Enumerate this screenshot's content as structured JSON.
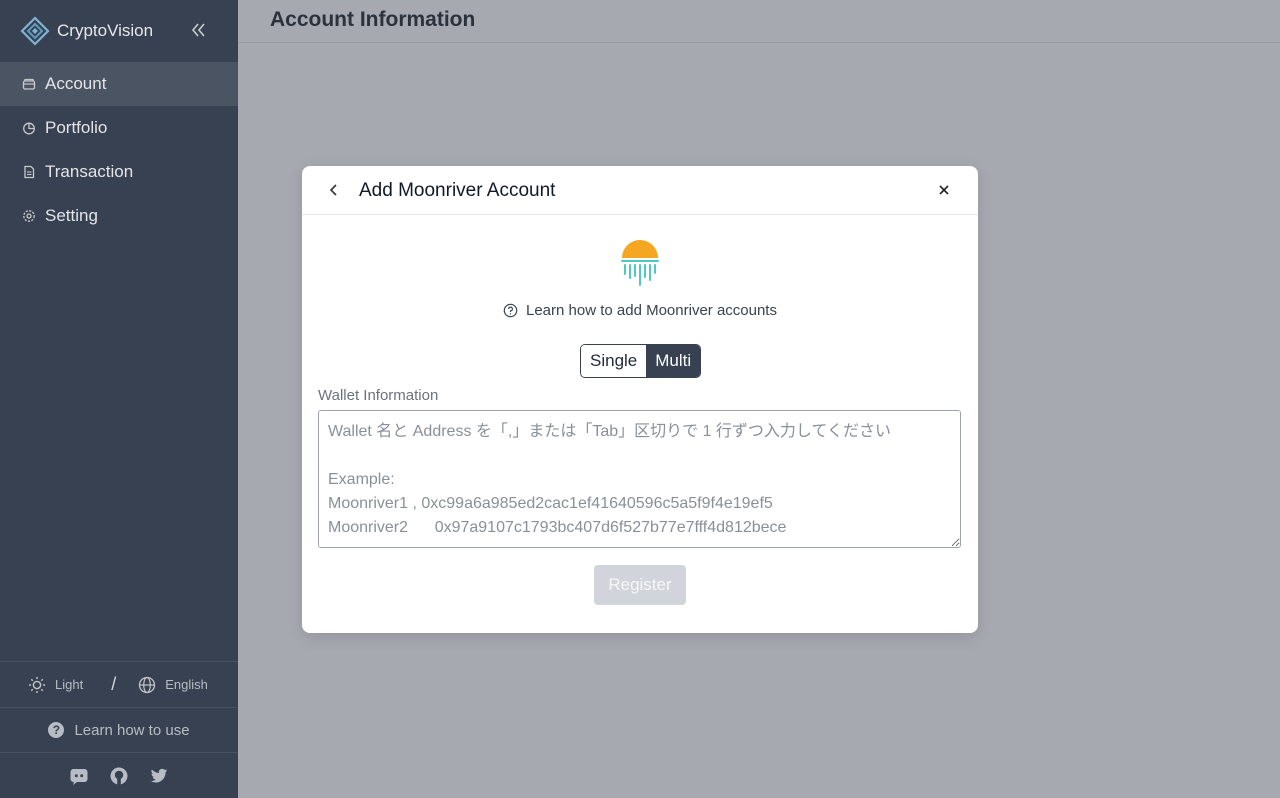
{
  "app": {
    "name": "CryptoVision"
  },
  "sidebar": {
    "items": [
      {
        "label": "Account",
        "icon": "account-icon",
        "active": true
      },
      {
        "label": "Portfolio",
        "icon": "pie-chart-icon",
        "active": false
      },
      {
        "label": "Transaction",
        "icon": "document-icon",
        "active": false
      },
      {
        "label": "Setting",
        "icon": "gear-icon",
        "active": false
      }
    ],
    "theme_label": "Light",
    "language_label": "English",
    "separator": "/",
    "help_label": "Learn how to use",
    "help_glyph": "?",
    "social": [
      "discord-icon",
      "github-icon",
      "twitter-icon"
    ]
  },
  "header": {
    "title": "Account Information"
  },
  "modal": {
    "title": "Add Moonriver Account",
    "learn_link": "Learn how to add Moonriver accounts",
    "modes": {
      "single": "Single",
      "multi": "Multi",
      "selected": "Multi"
    },
    "field_label": "Wallet Information",
    "placeholder": "Wallet 名と Address を「,」または「Tab」区切りで 1 行ずつ入力してください\n\nExample:\nMoonriver1 , 0xc99a6a985ed2cac1ef41640596c5a5f9f4e19ef5\nMoonriver2\t0x97a9107c1793bc407d6f527b77e7fff4d812bece",
    "register_label": "Register"
  },
  "colors": {
    "sidebar_bg": "#374151",
    "overlay_bg": "#a6a9b0",
    "accent": "#374151",
    "moon_orange": "#f5a623",
    "moon_teal": "#4ec9c0",
    "disabled_button": "#d1d5db"
  }
}
